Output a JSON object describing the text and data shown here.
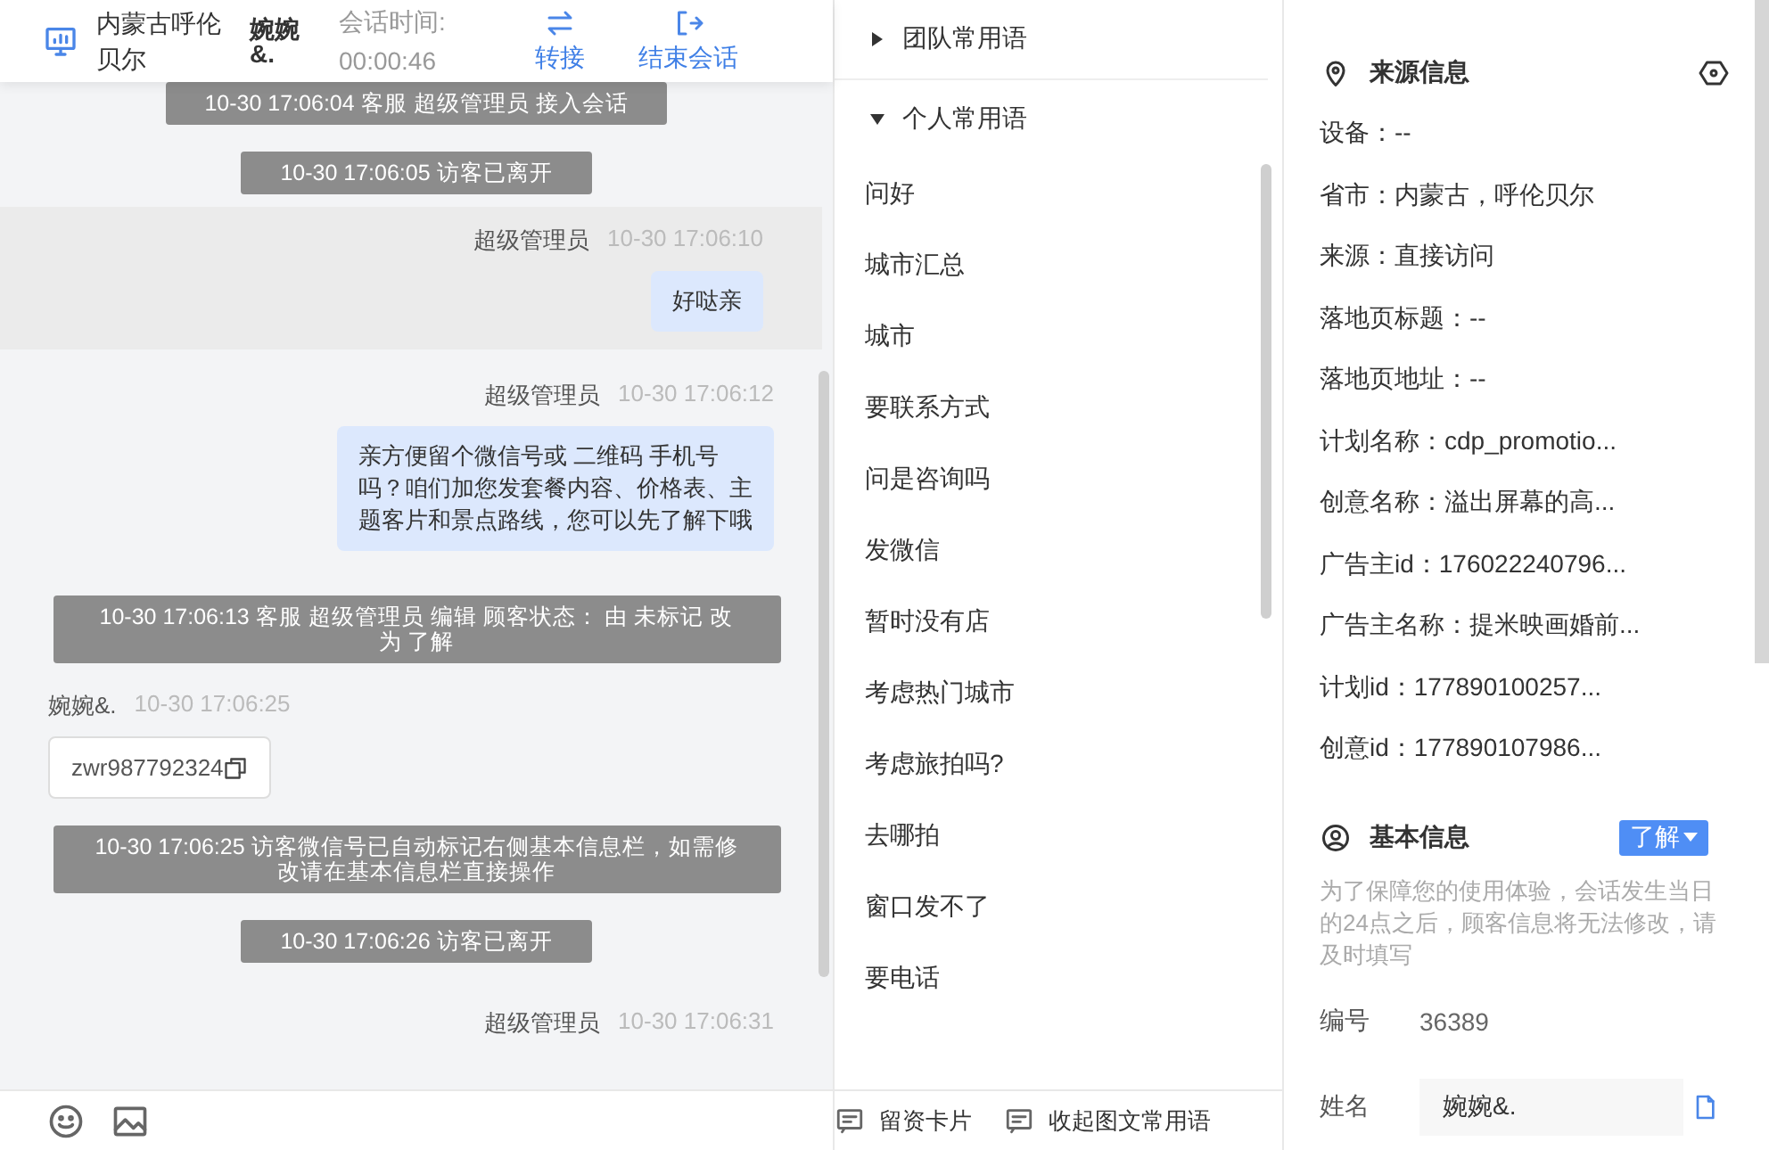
{
  "chat": {
    "header": {
      "location": "内蒙古呼伦贝尔",
      "visitor": "婉婉&.",
      "duration_label": "会话时间:",
      "duration": "00:00:46",
      "actions": [
        {
          "kind": "transfer",
          "label": "转接"
        },
        {
          "kind": "end",
          "label": "结束会话"
        }
      ]
    },
    "messages": [
      {
        "kind": "system",
        "text": "10-30 17:06:04 客服 超级管理员 接入会话"
      },
      {
        "kind": "system",
        "text": "10-30 17:06:05 访客已离开"
      },
      {
        "kind": "agent",
        "sender": "超级管理员",
        "time": "10-30 17:06:10",
        "text": "好哒亲",
        "highlighted": true
      },
      {
        "kind": "agent",
        "sender": "超级管理员",
        "time": "10-30 17:06:12",
        "text": "亲方便留个微信号或 二维码 手机号吗？咱们加您发套餐内容、价格表、主题客片和景点路线，您可以先了解下哦",
        "highlighted": false
      },
      {
        "kind": "system",
        "text": "10-30 17:06:13 客服 超级管理员 编辑 顾客状态： 由 未标记 改为 了解"
      },
      {
        "kind": "visitor",
        "sender": "婉婉&.",
        "time": "10-30 17:06:25",
        "text": "zwr987792324"
      },
      {
        "kind": "system",
        "text": "10-30 17:06:25 访客微信号已自动标记右侧基本信息栏，如需修改请在基本信息栏直接操作"
      },
      {
        "kind": "system",
        "text": "10-30 17:06:26 访客已离开"
      },
      {
        "kind": "agent",
        "sender": "超级管理员",
        "time": "10-30 17:06:31",
        "highlighted": false
      }
    ]
  },
  "phrases": {
    "groups": [
      {
        "label": "团队常用语",
        "expanded": false
      },
      {
        "label": "个人常用语",
        "expanded": true,
        "items": [
          "问好",
          "城市汇总",
          "城市",
          "要联系方式",
          "问是咨询吗",
          "发微信",
          "暂时没有店",
          "考虑热门城市",
          "考虑旅拍吗?",
          "去哪拍",
          "窗口发不了",
          "要电话"
        ]
      }
    ],
    "footer": [
      "留资卡片",
      "收起图文常用语"
    ]
  },
  "info": {
    "source": {
      "title": "来源信息",
      "fields": [
        "设备：--",
        "省市：内蒙古，呼伦贝尔",
        "来源：直接访问",
        "落地页标题：--",
        "落地页地址：--",
        "计划名称：cdp_promotio...",
        "创意名称：溢出屏幕的高...",
        "广告主id：176022240796...",
        "广告主名称：提米映画婚前...",
        "计划id：177890100257...",
        "创意id：177890107986..."
      ]
    },
    "basic": {
      "title": "基本信息",
      "status": "了解",
      "note": "为了保障您的使用体验，会话发生当日的24点之后，顾客信息将无法修改，请及时填写",
      "fields": [
        {
          "kind": "text",
          "label": "编号",
          "value": "36389"
        },
        {
          "kind": "input",
          "label": "姓名",
          "value": "婉婉&."
        }
      ]
    }
  }
}
